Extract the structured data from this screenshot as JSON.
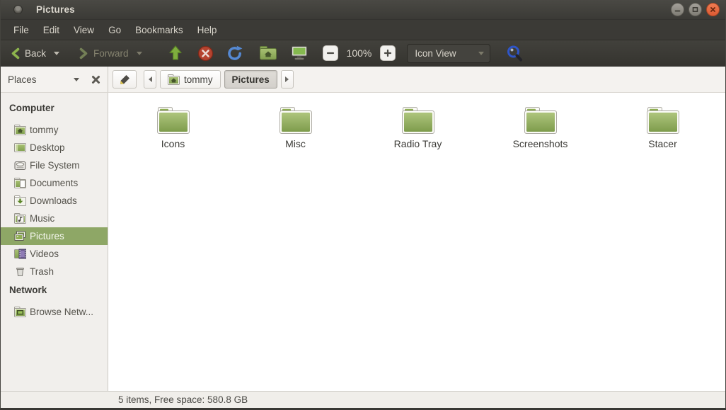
{
  "window": {
    "title": "Pictures",
    "controls": {
      "minimize": "minimize-button",
      "maximize": "maximize-button",
      "close": "close-button"
    }
  },
  "menu": {
    "items": [
      "File",
      "Edit",
      "View",
      "Go",
      "Bookmarks",
      "Help"
    ]
  },
  "toolbar": {
    "back_label": "Back",
    "forward_label": "Forward",
    "zoom_level": "100%",
    "view_mode": "Icon View",
    "icons": [
      "back-chevron-icon",
      "forward-chevron-icon",
      "up-arrow-icon",
      "stop-icon",
      "refresh-icon",
      "home-folder-icon",
      "desktop-icon",
      "zoom-out-icon",
      "zoom-in-icon",
      "search-icon"
    ]
  },
  "pathbar": {
    "places_label": "Places",
    "icons": [
      "places-caret-icon",
      "close-pane-icon",
      "edit-path-icon",
      "prev-crumb-icon",
      "next-crumb-icon"
    ],
    "crumbs": [
      {
        "label": "tommy",
        "icon": "home-folder-icon",
        "active": false
      },
      {
        "label": "Pictures",
        "icon": null,
        "active": true
      }
    ]
  },
  "sidebar": {
    "items": [
      {
        "label": "Computer",
        "type": "header"
      },
      {
        "label": "tommy",
        "icon": "home-folder-icon"
      },
      {
        "label": "Desktop",
        "icon": "desktop-icon"
      },
      {
        "label": "File System",
        "icon": "file-system-icon"
      },
      {
        "label": "Documents",
        "icon": "documents-folder-icon"
      },
      {
        "label": "Downloads",
        "icon": "downloads-folder-icon"
      },
      {
        "label": "Music",
        "icon": "music-folder-icon"
      },
      {
        "label": "Pictures",
        "icon": "pictures-folder-icon",
        "selected": true
      },
      {
        "label": "Videos",
        "icon": "videos-folder-icon"
      },
      {
        "label": "Trash",
        "icon": "trash-icon"
      },
      {
        "label": "Network",
        "type": "header"
      },
      {
        "label": "Browse Netw...",
        "icon": "network-folder-icon"
      }
    ]
  },
  "content": {
    "folders": [
      {
        "name": "Icons"
      },
      {
        "name": "Misc"
      },
      {
        "name": "Radio Tray"
      },
      {
        "name": "Screenshots"
      },
      {
        "name": "Stacer"
      }
    ]
  },
  "statusbar": {
    "text": "5 items, Free space: 580.8 GB"
  },
  "colors": {
    "titlebar": "#3b3a36",
    "selection_green": "#8ea766",
    "folder_green": "#93ad5d",
    "close_button": "#e0653f",
    "pathbar_bg": "#f4f2ef",
    "sidebar_bg": "#f1efec"
  }
}
